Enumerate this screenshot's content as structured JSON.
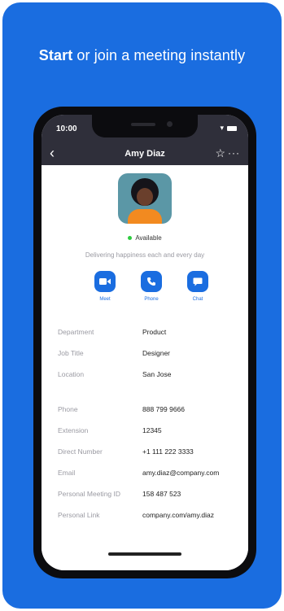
{
  "headline": {
    "bold": "Start",
    "rest": " or join a meeting instantly"
  },
  "statusbar": {
    "time": "10:00"
  },
  "navbar": {
    "back_icon": "‹",
    "title": "Amy Diaz",
    "star_icon": "☆",
    "more_icon": "···"
  },
  "profile": {
    "availability": "Available",
    "status_message": "Delivering happiness each and every day"
  },
  "actions": [
    {
      "label": "Meet",
      "icon": "video-icon"
    },
    {
      "label": "Phone",
      "icon": "phone-icon"
    },
    {
      "label": "Chat",
      "icon": "chat-icon"
    }
  ],
  "details": [
    {
      "label": "Department",
      "value": "Product"
    },
    {
      "label": "Job Title",
      "value": "Designer"
    },
    {
      "label": "Location",
      "value": "San Jose"
    },
    {
      "label": "Phone",
      "value": "888 799 9666"
    },
    {
      "label": "Extension",
      "value": "12345"
    },
    {
      "label": "Direct Number",
      "value": "+1 111 222 3333"
    },
    {
      "label": "Email",
      "value": "amy.diaz@company.com"
    },
    {
      "label": "Personal Meeting ID",
      "value": "158 487 523"
    },
    {
      "label": "Personal Link",
      "value": "company.com/amy.diaz"
    }
  ],
  "colors": {
    "background_blue": "#1a6de0",
    "navbar": "#2f2f3a",
    "available_green": "#2ecc40"
  }
}
